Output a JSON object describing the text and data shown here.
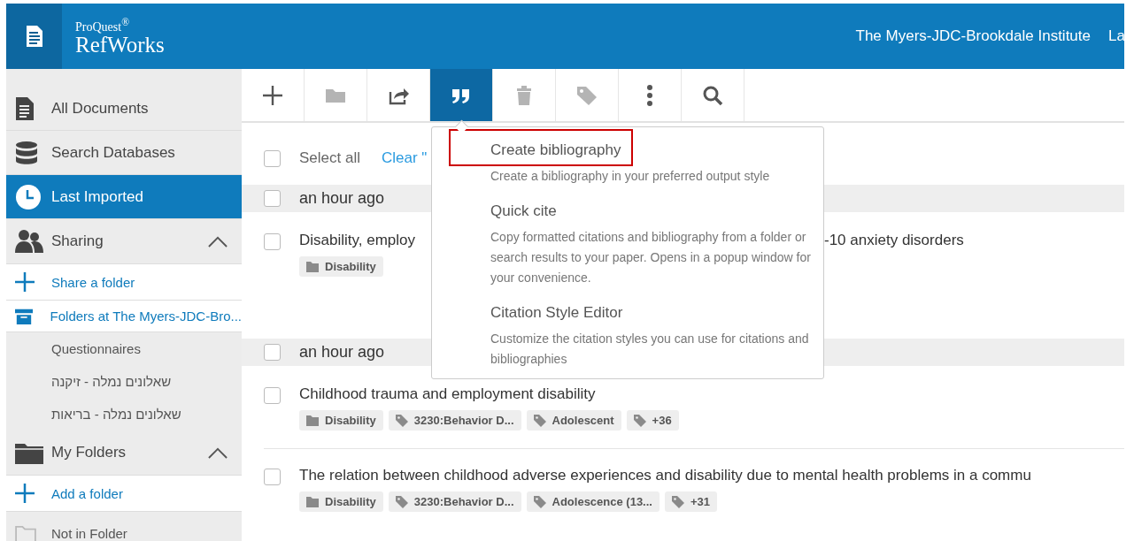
{
  "header": {
    "brand_top": "ProQuest$^{®}$",
    "brand": "RefWorks",
    "institution": "The Myers-JDC-Brookdale Institute",
    "menu_cut": "La"
  },
  "sidebar": {
    "items": [
      {
        "kind": "all",
        "label": "All Documents",
        "selected": false
      },
      {
        "kind": "databases",
        "label": "Search Databases",
        "selected": false
      },
      {
        "kind": "recent",
        "label": "Last Imported",
        "selected": true
      },
      {
        "kind": "sharing",
        "label": "Sharing",
        "expanded": true,
        "selected": false
      },
      {
        "kind": "add",
        "label": "Share a folder",
        "selected": false
      },
      {
        "kind": "shared",
        "label": "Folders at The Myers-JDC-Bro...",
        "selected": false
      },
      {
        "kind": "sub",
        "label": "Questionnaires",
        "selected": false
      },
      {
        "kind": "sub",
        "label": "שאלונים נמלה - זיקנה",
        "selected": false
      },
      {
        "kind": "sub",
        "label": "שאלונים נמלה - בריאות",
        "selected": false
      },
      {
        "kind": "folders",
        "label": "My Folders",
        "expanded": true,
        "selected": false
      },
      {
        "kind": "add",
        "label": "Add a folder",
        "selected": false
      },
      {
        "kind": "unfiled",
        "label": "Not in Folder",
        "selected": false
      }
    ]
  },
  "toolbar": [
    {
      "kind": "add",
      "selected": false,
      "disabled": false
    },
    {
      "kind": "folder",
      "selected": false,
      "disabled": true
    },
    {
      "kind": "share",
      "selected": false,
      "disabled": false
    },
    {
      "kind": "cite",
      "selected": true,
      "disabled": false
    },
    {
      "kind": "delete",
      "selected": false,
      "disabled": true
    },
    {
      "kind": "tag",
      "selected": false,
      "disabled": true
    },
    {
      "kind": "more",
      "selected": false,
      "disabled": false
    },
    {
      "kind": "search",
      "selected": false,
      "disabled": false
    }
  ],
  "select_bar": {
    "select_all": "Select all",
    "checked": false,
    "clear": "Clear \""
  },
  "groups": [
    {
      "heading": "an hour ago",
      "checked": false,
      "records": [
        {
          "title_parts": [
            "Disability, employ",
            "-10 anxiety disorders"
          ],
          "checked": false,
          "chips": [
            {
              "kind": "folder",
              "label": "Disability"
            }
          ]
        }
      ]
    },
    {
      "heading": "an hour ago",
      "checked": false,
      "records": [
        {
          "title_parts": [
            "Childhood trauma and employment disability"
          ],
          "checked": false,
          "chips": [
            {
              "kind": "folder",
              "label": "Disability"
            },
            {
              "kind": "tag",
              "label": "3230:Behavior D..."
            },
            {
              "kind": "tag",
              "label": "Adolescent"
            },
            {
              "kind": "tag",
              "label": "+36"
            }
          ]
        },
        {
          "title_parts": [
            "The relation between childhood adverse experiences and disability due to mental health problems in a commu"
          ],
          "checked": false,
          "chips": [
            {
              "kind": "folder",
              "label": "Disability"
            },
            {
              "kind": "tag",
              "label": "3230:Behavior D..."
            },
            {
              "kind": "tag",
              "label": "Adolescence (13..."
            },
            {
              "kind": "tag",
              "label": "+31"
            }
          ]
        }
      ]
    }
  ],
  "cite_menu": {
    "items": [
      {
        "title": "Create bibliography",
        "description": "Create a bibliography in your preferred output style",
        "highlighted": true
      },
      {
        "title": "Quick cite",
        "description": "Copy formatted citations and bibliography from a folder or search results to your paper. Opens in a popup window for your convenience.",
        "highlighted": false
      },
      {
        "title": "Citation Style Editor",
        "description": "Customize the citation styles you can use for citations and bibliographies",
        "highlighted": false
      }
    ]
  }
}
